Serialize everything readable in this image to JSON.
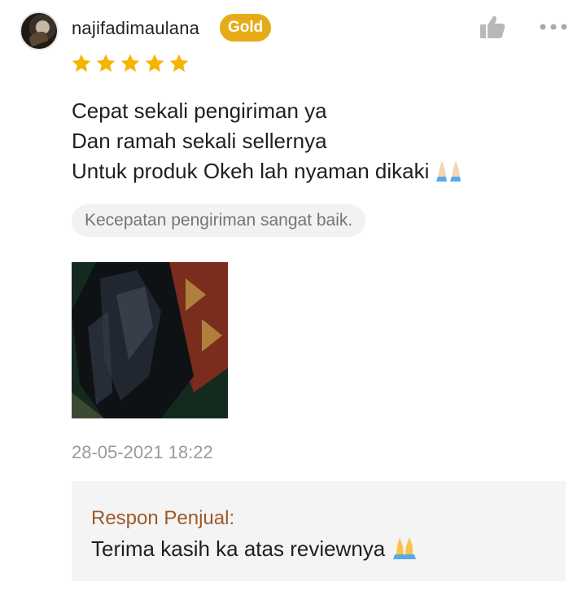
{
  "review": {
    "username": "najifadimaulana",
    "badge": "Gold",
    "rating": 5,
    "lines": [
      "Cepat sekali pengiriman ya",
      "Dan ramah sekali sellernya",
      "Untuk produk Okeh lah nyaman dikaki"
    ],
    "tag": "Kecepatan pengiriman sangat baik.",
    "timestamp": "28-05-2021 18:22"
  },
  "seller_reply": {
    "label": "Respon Penjual:",
    "text": "Terima kasih ka atas reviewnya"
  },
  "icons": {
    "like": "thumbs-up-icon",
    "more": "more-options-icon",
    "star": "star-icon",
    "emoji": "folded-hands-emoji"
  },
  "colors": {
    "badge_bg": "#e6ac18",
    "star": "#f6b400",
    "reply_label": "#9c5a2a",
    "icon_gray": "#b8b8b8"
  }
}
